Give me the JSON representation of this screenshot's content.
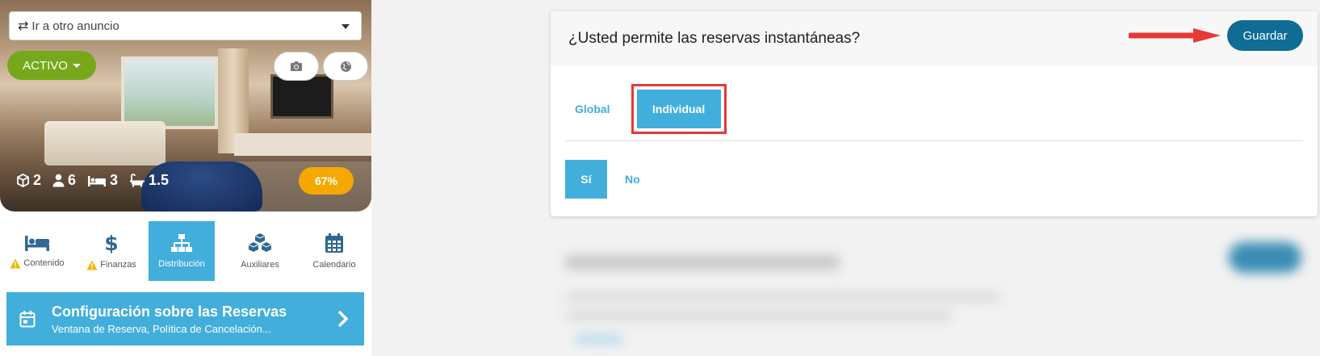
{
  "listing": {
    "select_placeholder": "Ir a otro anuncio",
    "status": "ACTIVO",
    "stats": {
      "units": "2",
      "guests": "6",
      "beds": "3",
      "baths": "1.5"
    },
    "completion": "67%"
  },
  "tabs": [
    {
      "label": "Contenido",
      "warning": true
    },
    {
      "label": "Finanzas",
      "warning": true
    },
    {
      "label": "Distribución",
      "warning": false,
      "active": true
    },
    {
      "label": "Auxiliares",
      "warning": false
    },
    {
      "label": "Calendario",
      "warning": false
    }
  ],
  "config": {
    "title": "Configuración sobre las Reservas",
    "subtitle": "Ventana de Reserva, Política de Cancelación..."
  },
  "card": {
    "question": "¿Usted permite las reservas instantáneas?",
    "save_label": "Guardar",
    "mode_global": "Global",
    "mode_individual": "Individual",
    "yes": "Sí",
    "no": "No"
  },
  "colors": {
    "accent": "#42aedc",
    "save": "#0e6c95",
    "active_status": "#77a81b",
    "completion": "#f5a800",
    "highlight": "#e53935"
  }
}
